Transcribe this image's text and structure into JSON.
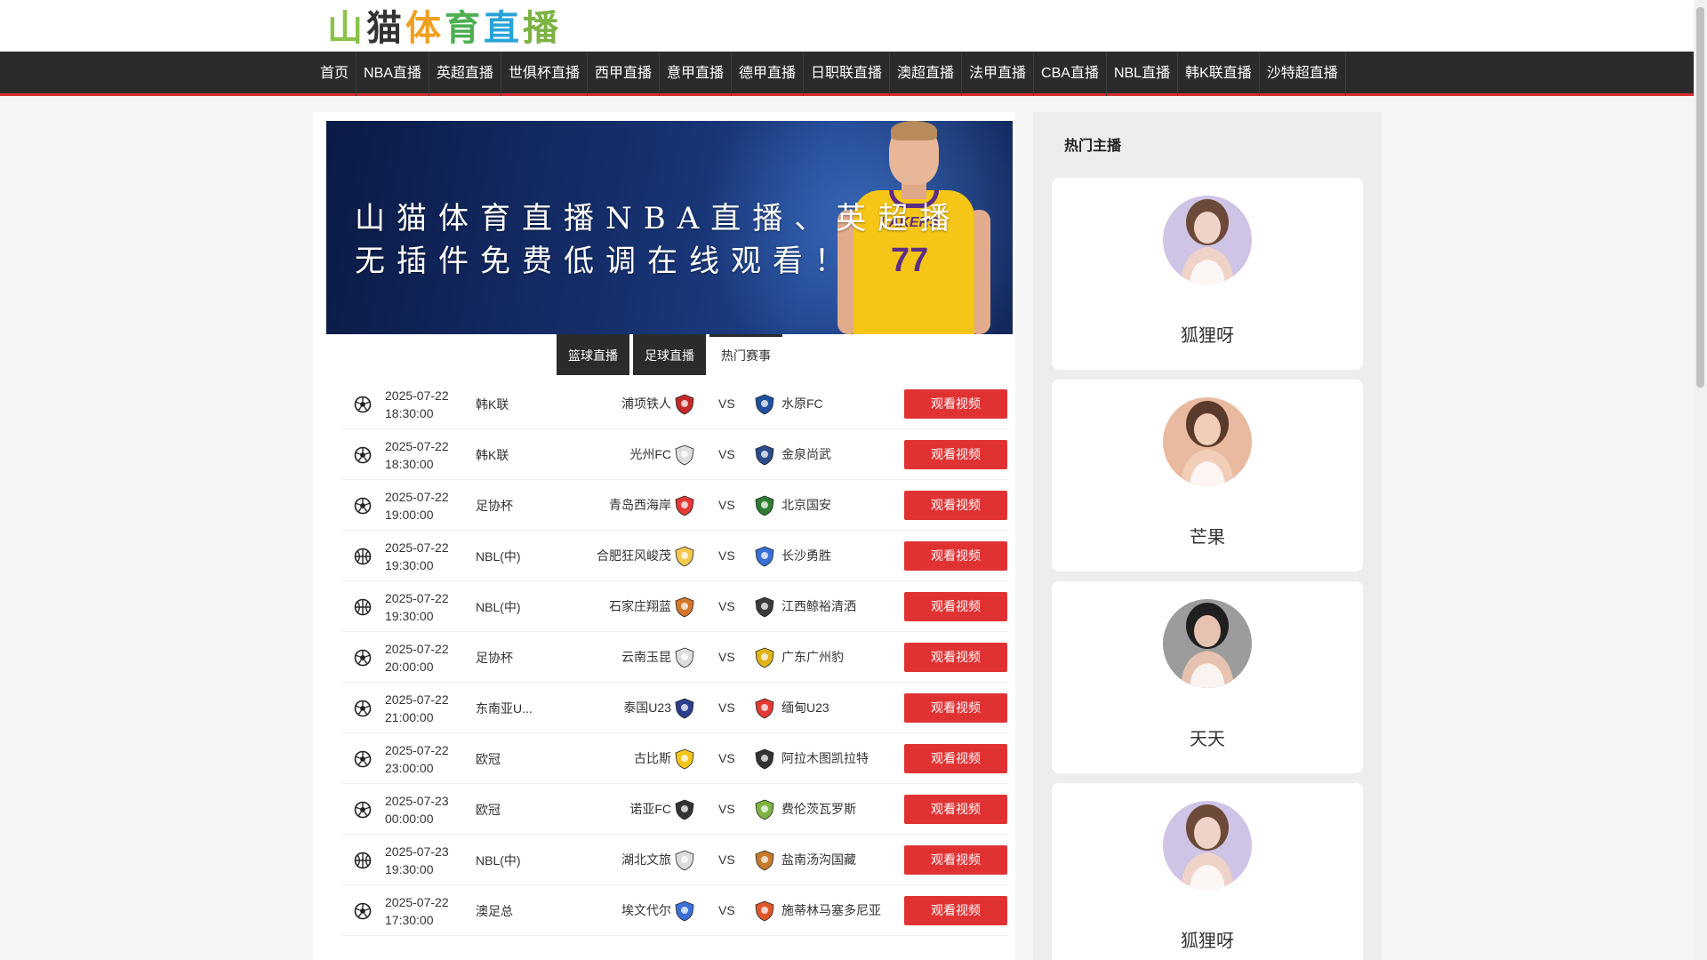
{
  "logo": {
    "chars": [
      "山",
      "猫",
      "体",
      "育",
      "直",
      "播"
    ],
    "colors": [
      "#8bc34a",
      "#333333",
      "#f0a020",
      "#4caf50",
      "#2aa3d8",
      "#7cb342"
    ]
  },
  "nav": {
    "items": [
      "首页",
      "NBA直播",
      "英超直播",
      "世俱杯直播",
      "西甲直播",
      "意甲直播",
      "德甲直播",
      "日职联直播",
      "澳超直播",
      "法甲直播",
      "CBA直播",
      "NBL直播",
      "韩K联直播",
      "沙特超直播"
    ]
  },
  "banner": {
    "line1": "山猫体育直播NBA直播、英超播",
    "line2": "无插件免费低调在线观看！",
    "player_number": "77",
    "jersey_text": "LAKERS"
  },
  "tabs": [
    {
      "label": "篮球直播",
      "active": false
    },
    {
      "label": "足球直播",
      "active": false
    },
    {
      "label": "热门赛事",
      "active": true
    }
  ],
  "matches": [
    {
      "sport": "football",
      "date": "2025-07-22",
      "time": "18:30:00",
      "league": "韩K联",
      "home": "浦项铁人",
      "home_color": "#c62828",
      "away": "水原FC",
      "away_color": "#1e4fa0",
      "button": "观看视频"
    },
    {
      "sport": "football",
      "date": "2025-07-22",
      "time": "18:30:00",
      "league": "韩K联",
      "home": "光州FC",
      "home_color": "#dddddd",
      "away": "金泉尚武",
      "away_color": "#2b4a8a",
      "button": "观看视频"
    },
    {
      "sport": "football",
      "date": "2025-07-22",
      "time": "19:00:00",
      "league": "足协杯",
      "home": "青岛西海岸",
      "home_color": "#e53935",
      "away": "北京国安",
      "away_color": "#2e7d32",
      "button": "观看视频"
    },
    {
      "sport": "basketball",
      "date": "2025-07-22",
      "time": "19:30:00",
      "league": "NBL(中)",
      "home": "合肥狂风峻茂",
      "home_color": "#f2c94c",
      "away": "长沙勇胜",
      "away_color": "#3a6fd8",
      "button": "观看视频"
    },
    {
      "sport": "basketball",
      "date": "2025-07-22",
      "time": "19:30:00",
      "league": "NBL(中)",
      "home": "石家庄翔蓝",
      "home_color": "#d4772a",
      "away": "江西鲸裕清洒",
      "away_color": "#3b3b3b",
      "button": "观看视频"
    },
    {
      "sport": "football",
      "date": "2025-07-22",
      "time": "20:00:00",
      "league": "足协杯",
      "home": "云南玉昆",
      "home_color": "#dddddd",
      "away": "广东广州豹",
      "away_color": "#e0b318",
      "button": "观看视频"
    },
    {
      "sport": "football",
      "date": "2025-07-22",
      "time": "21:00:00",
      "league": "东南亚U...",
      "home": "泰国U23",
      "home_color": "#2c3e8f",
      "away": "缅甸U23",
      "away_color": "#e53935",
      "button": "观看视频"
    },
    {
      "sport": "football",
      "date": "2025-07-22",
      "time": "23:00:00",
      "league": "欧冠",
      "home": "古比斯",
      "home_color": "#f5c518",
      "away": "阿拉木图凯拉特",
      "away_color": "#333333",
      "button": "观看视频"
    },
    {
      "sport": "football",
      "date": "2025-07-23",
      "time": "00:00:00",
      "league": "欧冠",
      "home": "诺亚FC",
      "home_color": "#333333",
      "away": "费伦茨瓦罗斯",
      "away_color": "#7cb342",
      "button": "观看视频"
    },
    {
      "sport": "basketball",
      "date": "2025-07-23",
      "time": "19:30:00",
      "league": "NBL(中)",
      "home": "湖北文旅",
      "home_color": "#dddddd",
      "away": "盐南汤沟国藏",
      "away_color": "#c77b2a",
      "button": "观看视频"
    },
    {
      "sport": "football",
      "date": "2025-07-22",
      "time": "17:30:00",
      "league": "澳足总",
      "home": "埃文代尔",
      "home_color": "#3b6fd8",
      "away": "施蒂林马塞多尼亚",
      "away_color": "#e0562a",
      "button": "观看视频"
    }
  ],
  "sidebar": {
    "title": "热门主播",
    "streamers": [
      {
        "name": "狐狸呀",
        "skin": "#f0d3c8",
        "hair": "#6b4a3a",
        "bg": "#cfc3e6"
      },
      {
        "name": "芒果",
        "skin": "#f2cdb8",
        "hair": "#5a3a2a",
        "bg": "#e9b9a0"
      },
      {
        "name": "天天",
        "skin": "#e6c2b0",
        "hair": "#1f1f1f",
        "bg": "#9c9c9c"
      },
      {
        "name": "狐狸呀",
        "skin": "#f0d3c8",
        "hair": "#6b4a3a",
        "bg": "#cfc3e6"
      }
    ]
  }
}
